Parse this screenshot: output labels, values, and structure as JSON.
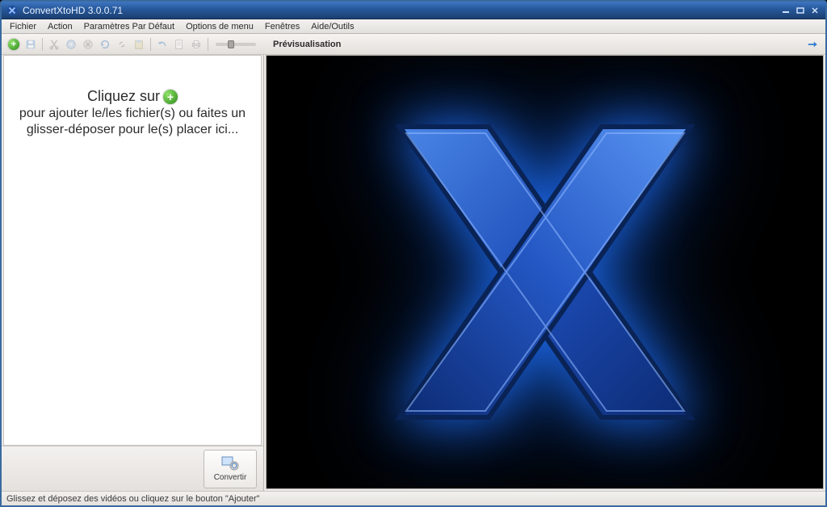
{
  "window": {
    "title": "ConvertXtoHD 3.0.0.71"
  },
  "menu": {
    "items": [
      "Fichier",
      "Action",
      "Paramètres Par Défaut",
      "Options de menu",
      "Fenêtres",
      "Aide/Outils"
    ]
  },
  "toolbar": {
    "icons": [
      "add-icon",
      "save-icon",
      "cut-icon",
      "disc-icon",
      "delete-icon",
      "refresh-icon",
      "link-icon",
      "paste-icon",
      "undo-icon",
      "page-icon",
      "print-icon"
    ]
  },
  "preview": {
    "label": "Prévisualisation",
    "right_icon": "fullscreen-icon"
  },
  "drop": {
    "line1_pre": "Cliquez sur",
    "line2": "pour ajouter le/les fichier(s) ou faites un",
    "line3": "glisser-déposer pour le(s) placer ici..."
  },
  "convert": {
    "label": "Convertir",
    "icon": "convert-icon"
  },
  "status": {
    "text": "Glissez et déposez des vidéos ou cliquez sur le bouton \"Ajouter\""
  },
  "colors": {
    "accent": "#2a5fb0",
    "titlebar_grad_top": "#3f77c2",
    "titlebar_grad_bot": "#1b3f70"
  }
}
